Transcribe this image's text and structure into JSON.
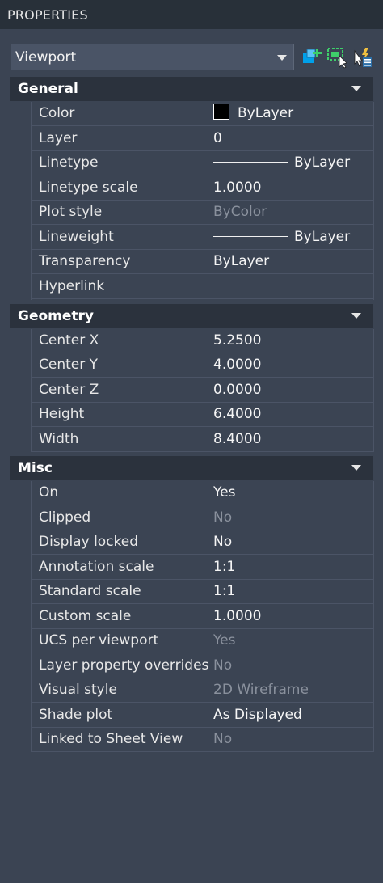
{
  "panel": {
    "title": "PROPERTIES"
  },
  "selector": {
    "value": "Viewport"
  },
  "toolbar": {
    "icons": [
      "toggle-pickadd-icon",
      "select-objects-icon",
      "quick-select-icon"
    ]
  },
  "sections": {
    "general": {
      "name": "General",
      "rows": [
        {
          "label": "Color",
          "value": "ByLayer"
        },
        {
          "label": "Layer",
          "value": "0"
        },
        {
          "label": "Linetype",
          "value": "ByLayer"
        },
        {
          "label": "Linetype scale",
          "value": "1.0000"
        },
        {
          "label": "Plot style",
          "value": "ByColor"
        },
        {
          "label": "Lineweight",
          "value": "ByLayer"
        },
        {
          "label": "Transparency",
          "value": "ByLayer"
        },
        {
          "label": "Hyperlink",
          "value": ""
        }
      ]
    },
    "geometry": {
      "name": "Geometry",
      "rows": [
        {
          "label": "Center X",
          "value": "5.2500"
        },
        {
          "label": "Center Y",
          "value": "4.0000"
        },
        {
          "label": "Center Z",
          "value": "0.0000"
        },
        {
          "label": "Height",
          "value": "6.4000"
        },
        {
          "label": "Width",
          "value": "8.4000"
        }
      ]
    },
    "misc": {
      "name": "Misc",
      "rows": [
        {
          "label": "On",
          "value": "Yes"
        },
        {
          "label": "Clipped",
          "value": "No"
        },
        {
          "label": "Display locked",
          "value": "No"
        },
        {
          "label": "Annotation scale",
          "value": "1:1"
        },
        {
          "label": "Standard scale",
          "value": "1:1"
        },
        {
          "label": "Custom scale",
          "value": "1.0000"
        },
        {
          "label": "UCS per viewport",
          "value": "Yes"
        },
        {
          "label": "Layer property overrides",
          "value": "No"
        },
        {
          "label": "Visual style",
          "value": "2D Wireframe"
        },
        {
          "label": "Shade plot",
          "value": "As Displayed"
        },
        {
          "label": "Linked to Sheet View",
          "value": "No"
        }
      ]
    }
  },
  "colors": {
    "background": "#3b4453",
    "header": "#2b323d",
    "titlebar": "#283039",
    "dim_text": "#8a919d",
    "icon_accent": "#00a0e9",
    "icon_green": "#3ecf6a"
  }
}
